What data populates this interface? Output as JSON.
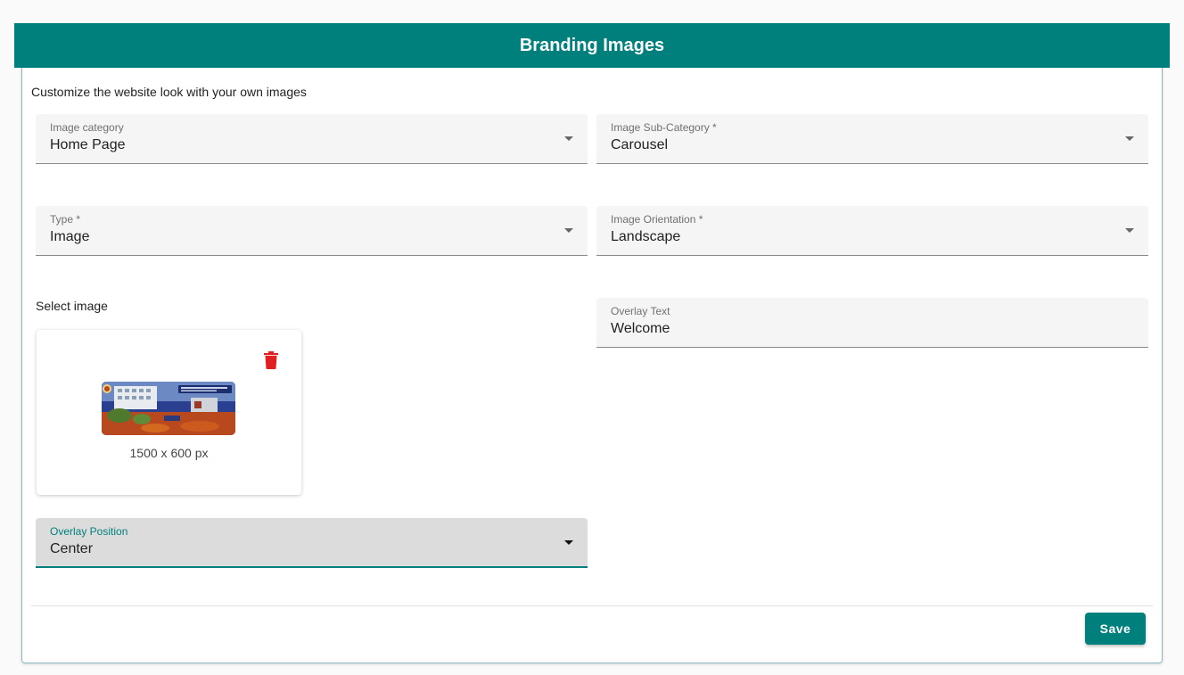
{
  "header": {
    "title": "Branding Images"
  },
  "form": {
    "subtitle": "Customize the website look with your own images",
    "image_category": {
      "label": "Image category",
      "value": "Home Page"
    },
    "image_sub_category": {
      "label": "Image Sub-Category *",
      "value": "Carousel"
    },
    "type": {
      "label": "Type *",
      "value": "Image"
    },
    "image_orientation": {
      "label": "Image Orientation *",
      "value": "Landscape"
    },
    "select_image": {
      "label": "Select image",
      "dimensions": "1500 x 600 px"
    },
    "overlay_text": {
      "label": "Overlay Text",
      "value": "Welcome"
    },
    "overlay_position": {
      "label": "Overlay Position",
      "value": "Center"
    }
  },
  "actions": {
    "save_label": "Save"
  },
  "colors": {
    "primary": "#00807d",
    "delete": "#e02020"
  },
  "icons": {
    "delete": "trash-icon",
    "dropdown": "arrow-drop-down-icon"
  }
}
